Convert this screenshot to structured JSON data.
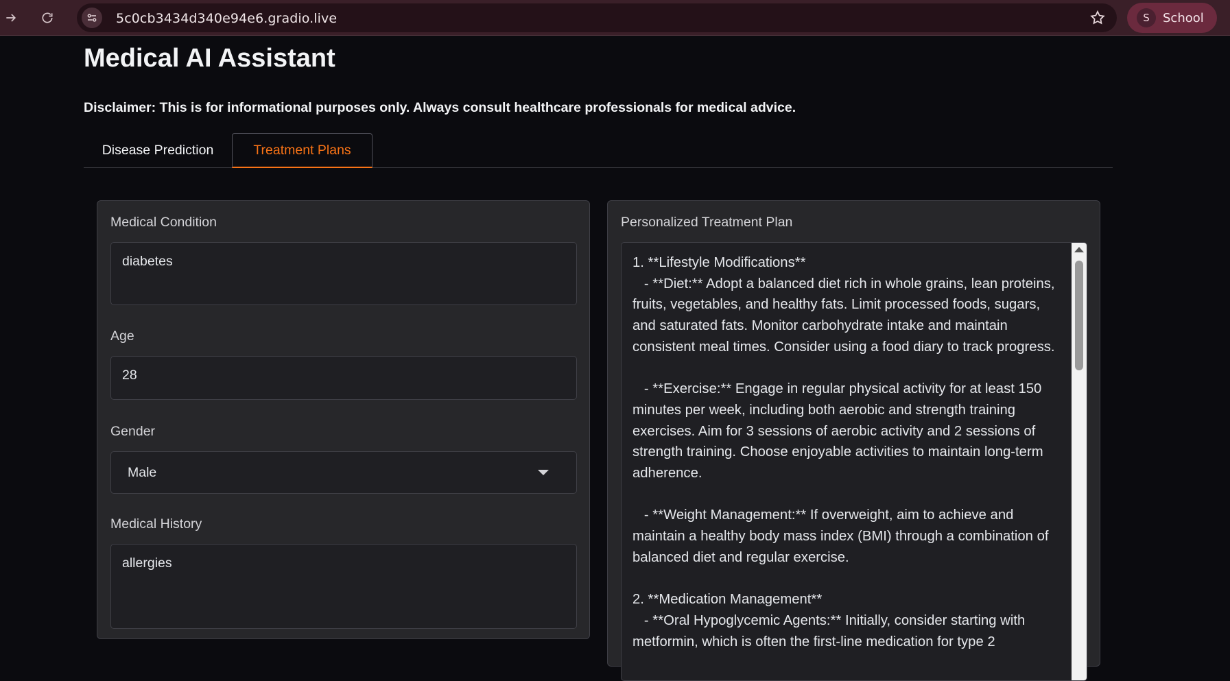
{
  "browser": {
    "url": "5c0cb3434d340e94e6.gradio.live",
    "profile_initial": "S",
    "profile_name": "School"
  },
  "page": {
    "title": "Medical AI Assistant",
    "disclaimer": "Disclaimer: This is for informational purposes only. Always consult healthcare professionals for medical advice."
  },
  "tabs": [
    {
      "label": "Disease Prediction",
      "active": false
    },
    {
      "label": "Treatment Plans",
      "active": true
    }
  ],
  "form": {
    "condition_label": "Medical Condition",
    "condition_value": "diabetes",
    "age_label": "Age",
    "age_value": "28",
    "gender_label": "Gender",
    "gender_value": "Male",
    "history_label": "Medical History",
    "history_value": "allergies"
  },
  "output": {
    "label": "Personalized Treatment Plan",
    "text": "1. **Lifestyle Modifications**\n   - **Diet:** Adopt a balanced diet rich in whole grains, lean proteins, fruits, vegetables, and healthy fats. Limit processed foods, sugars, and saturated fats. Monitor carbohydrate intake and maintain consistent meal times. Consider using a food diary to track progress.\n\n   - **Exercise:** Engage in regular physical activity for at least 150 minutes per week, including both aerobic and strength training exercises. Aim for 3 sessions of aerobic activity and 2 sessions of strength training. Choose enjoyable activities to maintain long-term adherence.\n\n   - **Weight Management:** If overweight, aim to achieve and maintain a healthy body mass index (BMI) through a combination of balanced diet and regular exercise.\n\n2. **Medication Management**\n   - **Oral Hypoglycemic Agents:** Initially, consider starting with metformin, which is often the first-line medication for type 2"
  },
  "colors": {
    "accent": "#f97316",
    "background": "#0b0b0f",
    "panel": "#27272a"
  },
  "icons": [
    "forward-arrow-icon",
    "reload-icon",
    "site-info-icon",
    "star-icon",
    "dropdown-caret-icon"
  ]
}
